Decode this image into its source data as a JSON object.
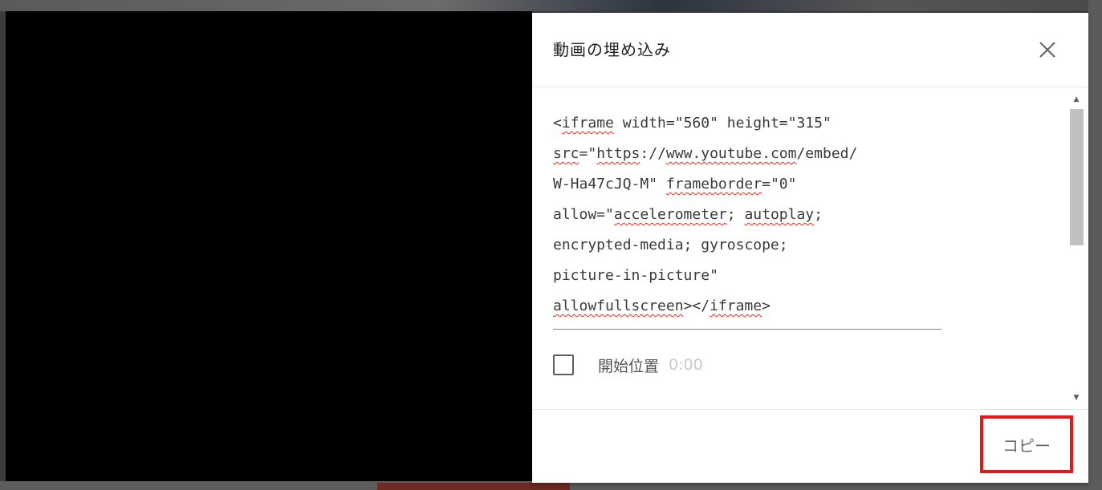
{
  "dialog": {
    "title": "動画の埋め込み",
    "close_icon": "close-icon"
  },
  "embed_code": {
    "lines": [
      [
        {
          "t": "<"
        },
        {
          "t": "iframe",
          "sq": true
        },
        {
          "t": " width=\"560\" height=\"315\""
        }
      ],
      [
        {
          "t": "src",
          "sq": true
        },
        {
          "t": "=\""
        },
        {
          "t": "https",
          "sq": true
        },
        {
          "t": "://"
        },
        {
          "t": "www.youtube.com",
          "sq": true
        },
        {
          "t": "/embed/"
        }
      ],
      [
        {
          "t": "W-Ha47cJQ-M\" "
        },
        {
          "t": "frameborder",
          "sq": true
        },
        {
          "t": "=\"0\""
        }
      ],
      [
        {
          "t": "allow=\""
        },
        {
          "t": "accelerometer",
          "sq": true
        },
        {
          "t": "; "
        },
        {
          "t": "autoplay",
          "sq": true
        },
        {
          "t": ";"
        }
      ],
      [
        {
          "t": "encrypted-media; gyroscope;"
        }
      ],
      [
        {
          "t": "picture-in-picture\""
        }
      ],
      [
        {
          "t": "allowfullscreen",
          "sq": true
        },
        {
          "t": "></"
        },
        {
          "t": "iframe",
          "sq": true
        },
        {
          "t": ">"
        }
      ]
    ]
  },
  "start_at": {
    "label": "開始位置",
    "time": "0:00",
    "checked": false
  },
  "footer": {
    "copy_label": "コピー"
  },
  "colors": {
    "highlight": "#e01a1a",
    "spell_error": "#d93025"
  }
}
